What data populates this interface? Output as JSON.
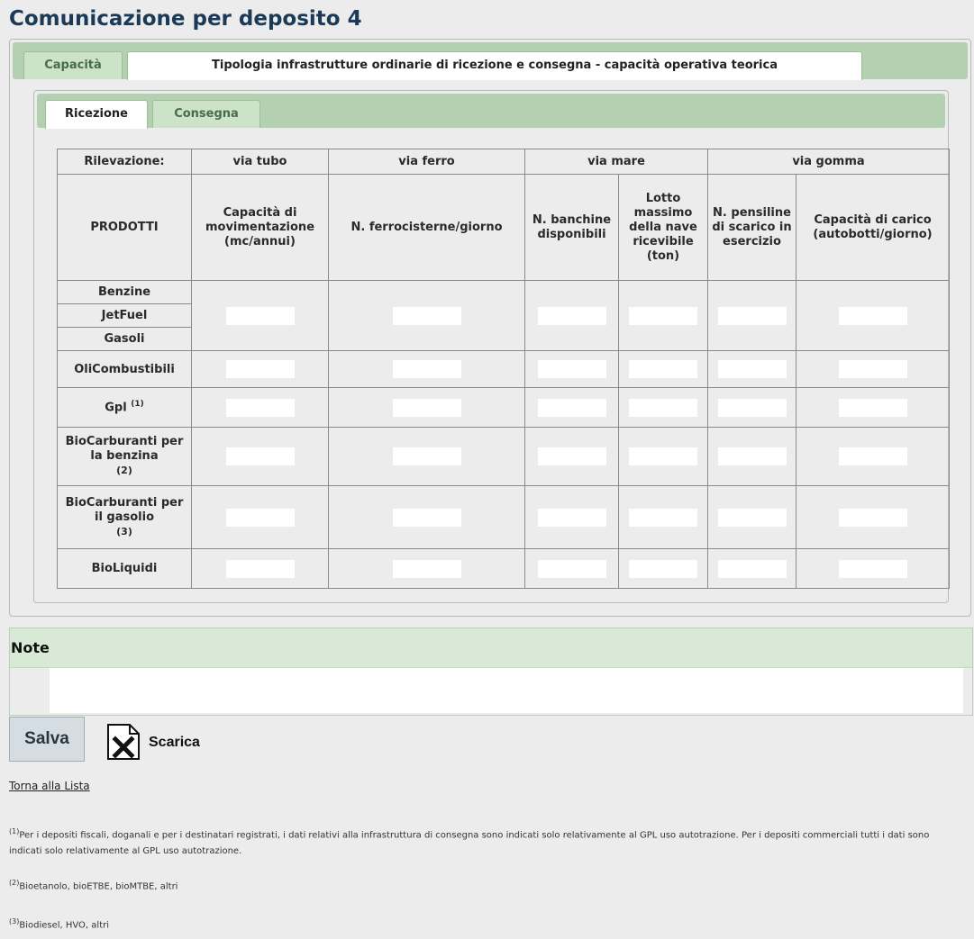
{
  "page_title": "Comunicazione per deposito 4",
  "outer_tabs": [
    "Capacità",
    "Tipologia infrastrutture ordinarie di ricezione e consegna - capacità operativa teorica"
  ],
  "inner_tabs": [
    "Ricezione",
    "Consegna"
  ],
  "table": {
    "group_header": {
      "rilevazione": "Rilevazione:",
      "via_tubo": "via tubo",
      "via_ferro": "via ferro",
      "via_mare": "via mare",
      "via_gomma": "via gomma"
    },
    "columns": {
      "prodotti": "PRODOTTI",
      "capacita_mov": "Capacità di movimentazione (mc/annui)",
      "ferrocisterne": "N. ferrocisterne/giorno",
      "banchine": "N. banchine disponibili",
      "lotto": "Lotto massimo della nave ricevibile (ton)",
      "pensiline": "N. pensiline di scarico in esercizio",
      "capacita_carico": "Capacità di carico (autobotti/giorno)"
    },
    "products": {
      "benzine": "Benzine",
      "jetfuel": "JetFuel",
      "gasoli": "Gasoli",
      "olicombustibili": "OliCombustibili",
      "gpl": "Gpl",
      "gpl_note": "(1)",
      "bio_benzina": "BioCarburanti per la benzina",
      "bio_benzina_note": "(2)",
      "bio_gasolio": "BioCarburanti per il gasolio",
      "bio_gasolio_note": "(3)",
      "bioliquidi": "BioLiquidi"
    }
  },
  "note": {
    "label": "Note",
    "value": ""
  },
  "actions": {
    "save_label": "Salva",
    "download_label": "Scarica",
    "download_icon": "excel-icon",
    "back_label": "Torna alla Lista"
  },
  "footnotes": [
    {
      "mark": "(1)",
      "text": "Per i depositi fiscali, doganali e per i destinatari registrati, i dati relativi alla infrastruttura di consegna sono indicati solo relativamente al GPL uso autotrazione. Per i depositi commerciali tutti i dati sono indicati solo relativamente al GPL uso autotrazione."
    },
    {
      "mark": "(2)",
      "text": "Bioetanolo, bioETBE, bioMTBE, altri"
    },
    {
      "mark": "(3)",
      "text": "Biodiesel, HVO, altri"
    }
  ],
  "colors": {
    "title": "#1b3a57",
    "tabbar": "#b3d1b0",
    "note_header": "#d8ead6",
    "button": "#d5dde2"
  }
}
